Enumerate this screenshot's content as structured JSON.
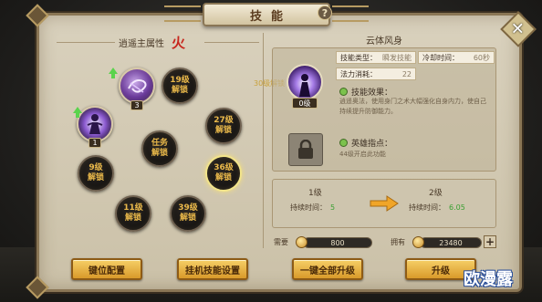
{
  "window": {
    "title": "技能",
    "help_icon": "?",
    "close_icon": "✕"
  },
  "left": {
    "attr_label": "逍遥主属性",
    "attr_value": "火",
    "floating_text": "30级解锁",
    "nodes": [
      {
        "id": "skill-a",
        "label": "",
        "level": "3",
        "type": "skill"
      },
      {
        "id": "skill-b",
        "label": "",
        "level": "1",
        "type": "skill2"
      },
      {
        "id": "lv19",
        "label": "19级\n解锁"
      },
      {
        "id": "lv27",
        "label": "27级\n解锁"
      },
      {
        "id": "task",
        "label": "任务\n解锁"
      },
      {
        "id": "lv9",
        "label": "9级\n解锁"
      },
      {
        "id": "lv36",
        "label": "36级\n解锁",
        "selected": true
      },
      {
        "id": "lv11",
        "label": "11级\n解锁"
      },
      {
        "id": "lv39",
        "label": "39级\n解锁"
      }
    ]
  },
  "skill": {
    "name": "云体风身",
    "level_badge": "0级",
    "type_label": "技能类型：",
    "type_value": "瞬发技能",
    "cooldown_label": "冷却时间：",
    "cooldown_value": "60秒",
    "cost_label": "法力消耗：",
    "cost_value": "22",
    "effect_head": "技能效果：",
    "effect_desc": "逍遥奥法，使用身门之术大幅强化自身内力，使自己持续提升防御能力。",
    "hero_head": "英雄指点：",
    "hero_desc": "44级开启此功能"
  },
  "compare": {
    "left_title": "1级",
    "left_label": "持续时间：",
    "left_value": "5",
    "right_title": "2级",
    "right_label": "持续时间：",
    "right_value": "6.05"
  },
  "cost": {
    "need_label": "需要",
    "need_value": "800",
    "have_label": "拥有",
    "have_value": "23480",
    "plus": "+"
  },
  "buttons": {
    "key_config": "键位配置",
    "auto_skill": "挂机技能设置",
    "upgrade_all": "一键全部升级",
    "upgrade": "升级"
  },
  "watermark": "欧漫露"
}
